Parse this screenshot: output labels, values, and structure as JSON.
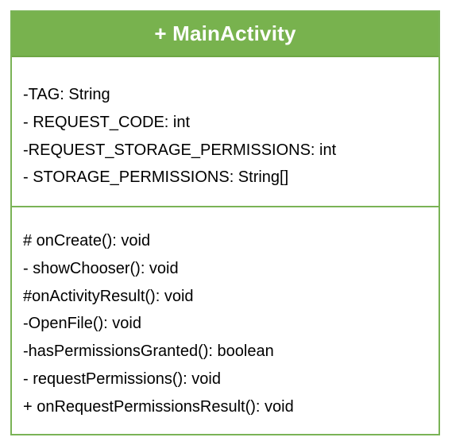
{
  "class": {
    "name": "+ MainActivity",
    "attributes": [
      "-TAG: String",
      "- REQUEST_CODE: int",
      "-REQUEST_STORAGE_PERMISSIONS: int",
      "- STORAGE_PERMISSIONS: String[]"
    ],
    "operations": [
      "# onCreate(): void",
      "- showChooser(): void",
      "#onActivityResult(): void",
      "-OpenFile(): void",
      "-hasPermissionsGranted(): boolean",
      "- requestPermissions(): void",
      "+ onRequestPermissionsResult(): void"
    ]
  },
  "colors": {
    "header_fill": "#78b24e",
    "border": "#7ab356",
    "title_text": "#ffffff",
    "body_text": "#000000"
  }
}
